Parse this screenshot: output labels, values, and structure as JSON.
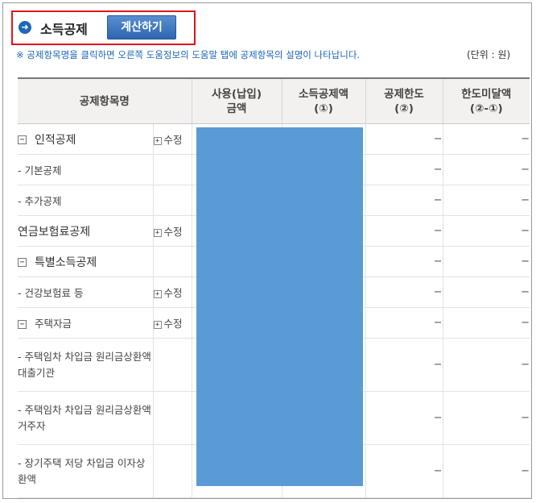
{
  "header": {
    "title": "소득공제",
    "calc_button": "계산하기",
    "notice": "※ 공제항목명을 클릭하면 오른쪽 도움정보의 도움말 탭에 공제항목의 설명이 나타납니다.",
    "unit": "(단위 : 원)"
  },
  "colors": {
    "accent": "#1f68b5",
    "highlight_border": "#e0141b",
    "redaction": "#5b9bd5"
  },
  "columns": {
    "name": "공제항목명",
    "used_1": "사용(납입)",
    "used_2": "금액",
    "deduction_1": "소득공제액",
    "deduction_2": "(①)",
    "limit_1": "공제한도",
    "limit_2": "(②)",
    "remaining_1": "한도미달액",
    "remaining_2": "(②-①)"
  },
  "rows": [
    {
      "label": "인적공제",
      "toggle": "−",
      "edit": "수정",
      "limit": "−",
      "remaining": "−"
    },
    {
      "label": "- 기본공제",
      "limit": "−",
      "remaining": "−"
    },
    {
      "label": "- 추가공제",
      "limit": "−",
      "remaining": "−"
    },
    {
      "label": "연금보험료공제",
      "edit": "수정",
      "limit": "−",
      "remaining": "−"
    },
    {
      "label": "특별소득공제",
      "toggle": "−",
      "limit": "−",
      "remaining": "−"
    },
    {
      "label": "- 건강보험료 등",
      "edit": "수정",
      "limit": "−",
      "remaining": "−"
    },
    {
      "label": "주택자금",
      "toggle": "−",
      "edit": "수정",
      "limit": "−",
      "remaining": "−"
    },
    {
      "label": "- 주택임차 차입금 원리금상환액 대출기관",
      "limit": "−",
      "remaining": "−"
    },
    {
      "label": "- 주택임차 차입금 원리금상환액 거주자",
      "limit": "−",
      "remaining": "−"
    },
    {
      "label": "- 장기주택 저당 차입금 이자상환액",
      "limit": "−",
      "remaining": "−"
    }
  ]
}
